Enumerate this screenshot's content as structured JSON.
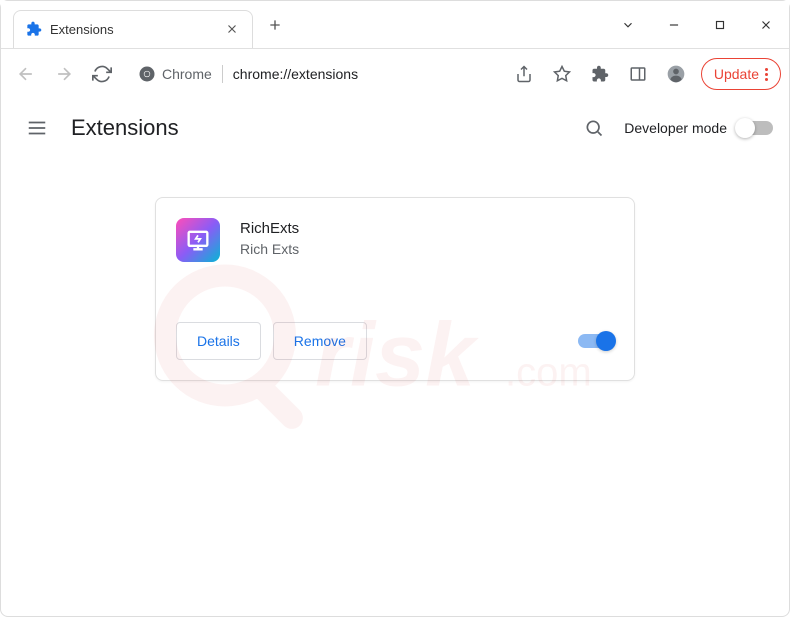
{
  "tab": {
    "title": "Extensions"
  },
  "address": {
    "origin": "Chrome",
    "url": "chrome://extensions"
  },
  "update_button": {
    "label": "Update"
  },
  "page": {
    "title": "Extensions",
    "developer_mode_label": "Developer mode"
  },
  "extension": {
    "name": "RichExts",
    "description": "Rich Exts",
    "details_label": "Details",
    "remove_label": "Remove",
    "enabled": true
  }
}
